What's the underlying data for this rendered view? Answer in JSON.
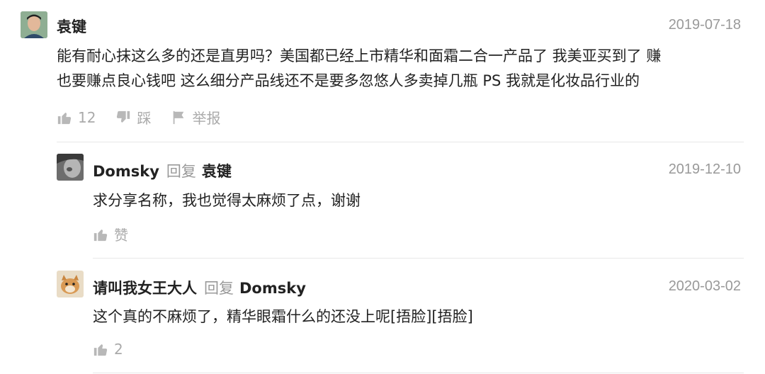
{
  "comments": [
    {
      "author": "袁键",
      "date": "2019-07-18",
      "lines": [
        "能有耐心抹这么多的还是直男吗？美国都已经上市精华和面霜二合一产品了 我美亚买到了 赚",
        "也要赚点良心钱吧 这么细分产品线还不是要多忽悠人多卖掉几瓶 PS 我就是化妆品行业的"
      ],
      "like_count": "12",
      "dislike_label": "踩",
      "report_label": "举报"
    }
  ],
  "replies": [
    {
      "author": "Domsky",
      "reply_word": "回复",
      "reply_to": "袁键",
      "date": "2019-12-10",
      "text": "求分享名称，我也觉得太麻烦了点，谢谢",
      "like_label": "赞"
    },
    {
      "author": "请叫我女王大人",
      "reply_word": "回复",
      "reply_to": "Domsky",
      "date": "2020-03-02",
      "text": "这个真的不麻烦了，精华眼霜什么的还没上呢[捂脸][捂脸]",
      "like_label": "2"
    }
  ]
}
